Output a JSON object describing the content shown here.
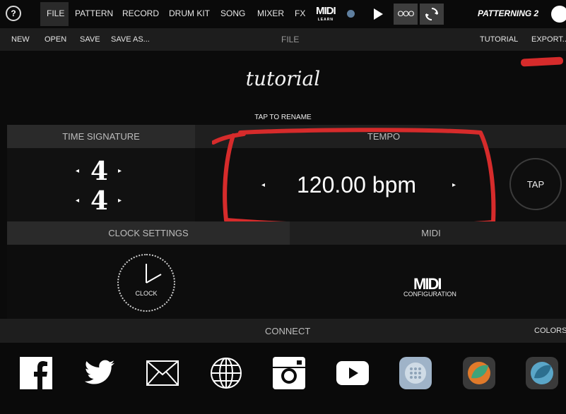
{
  "topnav": {
    "help": "?",
    "items": [
      "FILE",
      "PATTERN",
      "RECORD",
      "DRUM KIT",
      "SONG",
      "MIXER",
      "FX"
    ],
    "midi_learn_logo": "MIDI",
    "midi_learn_sub": "LEARN",
    "loop_label": "OOO",
    "brand": "PATTERNING 2"
  },
  "filebar": {
    "new": "NEW",
    "open": "OPEN",
    "save": "SAVE",
    "save_as": "SAVE AS...",
    "title": "FILE",
    "tutorial": "TUTORIAL",
    "export": "EXPORT..."
  },
  "project": {
    "name": "tutorial",
    "tap_to_rename": "TAP TO RENAME"
  },
  "sections": {
    "time_signature": "TIME SIGNATURE",
    "tempo": "TEMPO",
    "clock_settings": "CLOCK SETTINGS",
    "midi": "MIDI",
    "connect": "CONNECT",
    "colors": "COLORS"
  },
  "time_signature": {
    "numerator": "4",
    "denominator": "4"
  },
  "tempo": {
    "value": "120.00 bpm",
    "tap": "TAP"
  },
  "clock": {
    "label": "CLOCK"
  },
  "midi": {
    "logo": "MIDI",
    "label": "CONFIGURATION"
  },
  "colors": {
    "accent": "#d62b2b",
    "panel": "#111111",
    "header": "#1f1f1f"
  },
  "social_icons": [
    "facebook-icon",
    "twitter-icon",
    "mail-icon",
    "globe-icon",
    "instagram-icon",
    "youtube-icon",
    "app-icon-1",
    "app-icon-2",
    "app-icon-3"
  ]
}
